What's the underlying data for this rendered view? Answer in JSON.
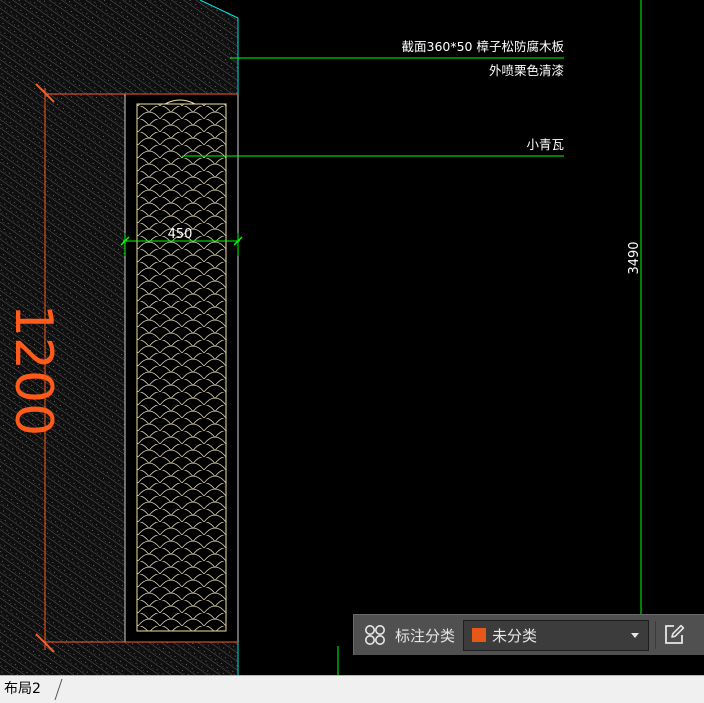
{
  "drawing": {
    "callouts": {
      "board_spec_line1": "截面360*50  樟子松防腐木板",
      "board_spec_line2": "外喷栗色清漆",
      "tile_label": "小青瓦"
    },
    "dimensions": {
      "width_450": "450",
      "height_3490": "3490",
      "height_1200": "1200"
    },
    "colors": {
      "background": "#000000",
      "leader_line": "#00ff00",
      "dimension_red": "#ff5a1a",
      "wall_edge_cyan": "#00e0e0",
      "tile_outline": "#f0e0a0",
      "text": "#ffffff"
    }
  },
  "toolbar": {
    "grid_icon": "four-circles-icon",
    "label": "标注分类",
    "category_value": "未分类",
    "category_color": "#e8571a",
    "dropdown_icon": "caret-down-icon",
    "edit_icon": "edit-note-icon"
  },
  "tabs": {
    "active_layout": "布局2"
  }
}
